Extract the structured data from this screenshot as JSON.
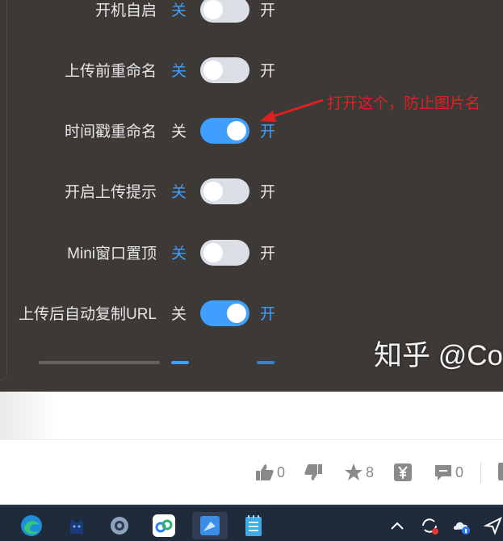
{
  "settings": {
    "off_label": "关",
    "on_label": "开",
    "rows": [
      {
        "label": "开机自启",
        "state": "off"
      },
      {
        "label": "上传前重命名",
        "state": "off"
      },
      {
        "label": "时间戳重命名",
        "state": "on"
      },
      {
        "label": "开启上传提示",
        "state": "off"
      },
      {
        "label": "Mini窗口置顶",
        "state": "off"
      },
      {
        "label": "上传后自动复制URL",
        "state": "on"
      }
    ]
  },
  "annotation": {
    "text": "打开这个，防止图片名"
  },
  "watermark": "知乎 @Co",
  "actions": {
    "like_count": "0",
    "favorite_count": "8",
    "comment_count": "0"
  },
  "colors": {
    "accent": "#409eff",
    "annotation": "#e02020",
    "panel_bg": "#3d3937"
  },
  "taskbar_icons": [
    "edge-icon",
    "cat-icon",
    "settings-gear-icon",
    "cloud-app-icon",
    "paint-icon",
    "notepad-icon",
    "chevron-up-icon",
    "refresh-icon",
    "weather-icon",
    "send-icon"
  ]
}
